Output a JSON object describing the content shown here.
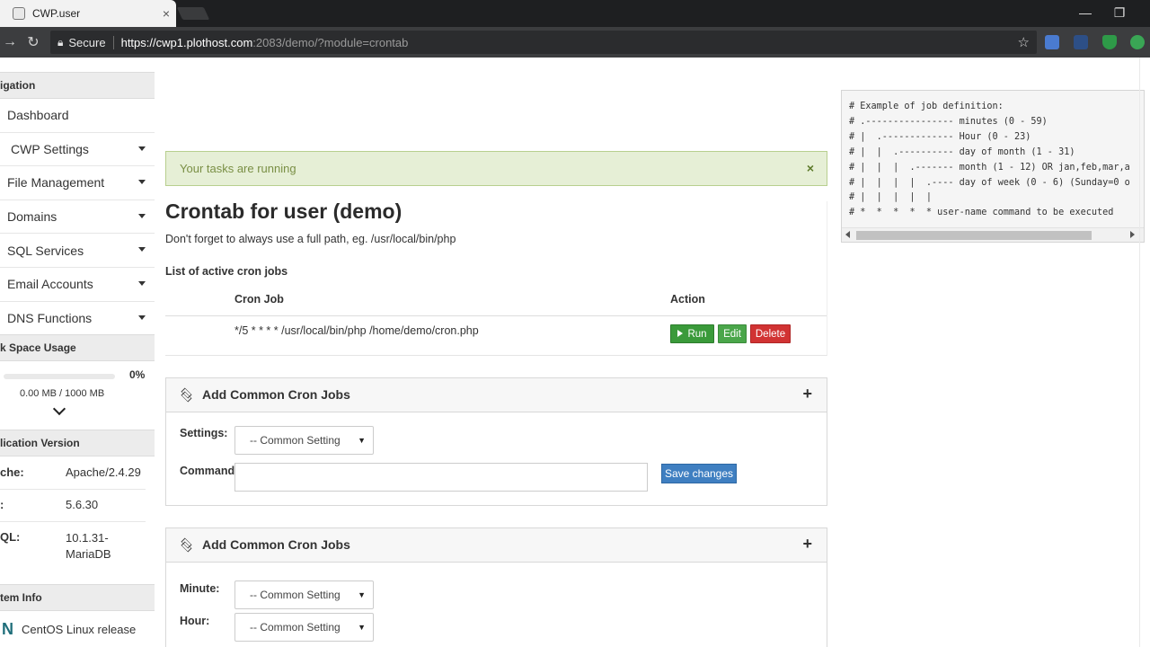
{
  "browser": {
    "tab_title": "CWP.user",
    "tab_close": "×",
    "secure_label": "Secure",
    "url_host": "https://cwp1.plothost.com",
    "url_rest": ":2083/demo/?module=crontab"
  },
  "sidebar": {
    "nav_header": "igation",
    "nav_items": [
      {
        "label": "Dashboard",
        "has_caret": false
      },
      {
        "label": "CWP Settings",
        "has_caret": true
      },
      {
        "label": "File Management",
        "has_caret": true
      },
      {
        "label": "Domains",
        "has_caret": true
      },
      {
        "label": "SQL Services",
        "has_caret": true
      },
      {
        "label": "Email Accounts",
        "has_caret": true
      },
      {
        "label": "DNS Functions",
        "has_caret": true
      }
    ],
    "disk_header": "k Space Usage",
    "disk_percent_label": "0%",
    "disk_fraction": 0,
    "disk_used": "0.00 MB / 1000 MB",
    "app_header": "lication Version",
    "app_versions": [
      {
        "key": "che:",
        "value": "Apache/2.4.29"
      },
      {
        "key": ":",
        "value": "5.6.30"
      },
      {
        "key": "QL:",
        "value": "10.1.31-MariaDB"
      }
    ],
    "system_header": "tem Info",
    "system_text": "CentOS Linux release"
  },
  "alert": {
    "message": "Your tasks are running",
    "close": "×"
  },
  "crontab": {
    "title": "Crontab for user (demo)",
    "hint": "Don't forget to always use a full path, eg. /usr/local/bin/php",
    "list_title": "List of active cron jobs",
    "col_job": "Cron Job",
    "col_action": "Action",
    "jobs": [
      {
        "command": "*/5 * * * * /usr/local/bin/php /home/demo/cron.php"
      }
    ],
    "run_label": "Run",
    "edit_label": "Edit",
    "delete_label": "Delete"
  },
  "box1": {
    "title": "Add Common Cron Jobs",
    "plus": "+",
    "settings_label": "Settings:",
    "settings_value": "-- Common Setting",
    "command_label": "Command",
    "save_label": "Save changes"
  },
  "box2": {
    "title": "Add Common Cron Jobs",
    "plus": "+",
    "minute_label": "Minute:",
    "minute_value": "-- Common Setting",
    "hour_label": "Hour:",
    "hour_value": "-- Common Setting"
  },
  "example": {
    "text": "# Example of job definition:\n# .---------------- minutes (0 - 59)\n# |  .------------- Hour (0 - 23)\n# |  |  .---------- day of month (1 - 31)\n# |  |  |  .------- month (1 - 12) OR jan,feb,mar,a\n# |  |  |  |  .---- day of week (0 - 6) (Sunday=0 o\n# |  |  |  |  |\n# *  *  *  *  * user-name command to be executed"
  },
  "icons": {
    "favicon": "cwp-favicon-icon",
    "back": "back-arrow-icon",
    "reload": "reload-icon",
    "lock": "lock-icon",
    "star": "bookmark-star-icon",
    "layers": "layers-icon",
    "play": "play-icon",
    "caret": "caret-down-icon",
    "chevron": "chevron-down-icon"
  },
  "colors": {
    "alert_bg": "#e6efd6",
    "alert_text": "#7a8f45",
    "run_green": "#3a9a3a",
    "delete_red": "#d13333",
    "save_blue": "#3f7fc1"
  }
}
